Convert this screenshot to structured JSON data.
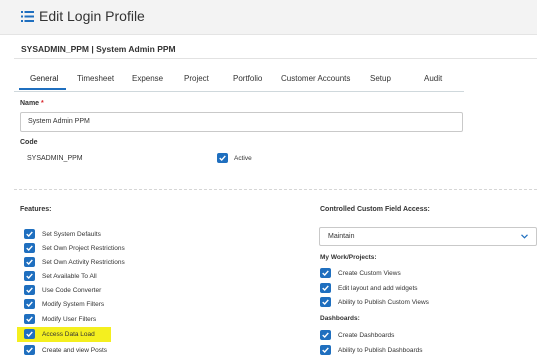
{
  "header": {
    "title": "Edit Login Profile",
    "icon": "list-icon"
  },
  "record": {
    "title": "SYSADMIN_PPM | System Admin PPM"
  },
  "tabs": [
    {
      "label": "General",
      "active": true
    },
    {
      "label": "Timesheet"
    },
    {
      "label": "Expense"
    },
    {
      "label": "Project"
    },
    {
      "label": "Portfolio"
    },
    {
      "label": "Customer Accounts"
    },
    {
      "label": "Setup"
    },
    {
      "label": "Audit"
    }
  ],
  "form": {
    "name_label": "Name",
    "required_mark": "*",
    "name_value": "System Admin PPM",
    "code_label": "Code",
    "code_value": "SYSADMIN_PPM",
    "active_label": "Active",
    "active_checked": true
  },
  "features": {
    "label": "Features:",
    "items": [
      {
        "label": "Set System Defaults",
        "checked": true
      },
      {
        "label": "Set Own Project Restrictions",
        "checked": true
      },
      {
        "label": "Set Own Activity Restrictions",
        "checked": true
      },
      {
        "label": "Set Available To All",
        "checked": true
      },
      {
        "label": "Use Code Converter",
        "checked": true
      },
      {
        "label": "Modify System Filters",
        "checked": true
      },
      {
        "label": "Modify User Filters",
        "checked": true
      },
      {
        "label": "Access Data Load",
        "checked": true,
        "highlighted": true
      },
      {
        "label": "Create and view Posts",
        "checked": true
      }
    ]
  },
  "custom_field_access": {
    "label": "Controlled Custom Field Access:",
    "selected": "Maintain"
  },
  "my_work": {
    "label": "My Work/Projects:",
    "items": [
      {
        "label": "Create Custom Views",
        "checked": true
      },
      {
        "label": "Edit layout and add widgets",
        "checked": true
      },
      {
        "label": "Ability to Publish Custom Views",
        "checked": true
      }
    ]
  },
  "dashboards": {
    "label": "Dashboards:",
    "items": [
      {
        "label": "Create Dashboards",
        "checked": true
      },
      {
        "label": "Ability to Publish Dashboards",
        "checked": true
      }
    ]
  },
  "colors": {
    "accent": "#1f6fbf",
    "highlight": "#f4ef1f",
    "required": "#d9252b"
  }
}
